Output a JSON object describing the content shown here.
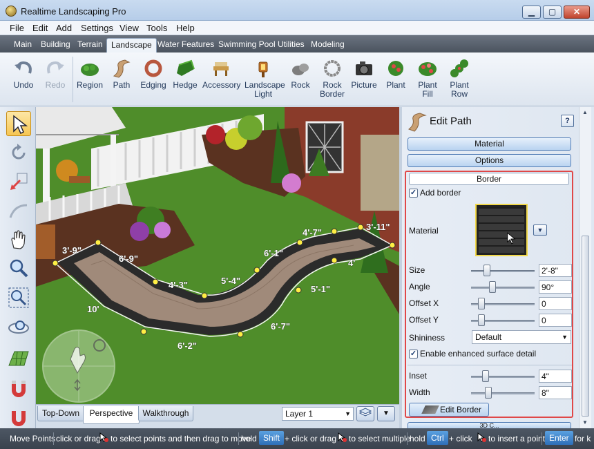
{
  "window": {
    "title": "Realtime Landscaping Pro",
    "controls": {
      "minimize": "▁",
      "maximize": "▢",
      "close": "✕"
    }
  },
  "menu": [
    "File",
    "Edit",
    "Add",
    "Settings",
    "View",
    "Tools",
    "Help"
  ],
  "tabs": [
    "Main",
    "Building",
    "Terrain",
    "Landscape",
    "Water Features",
    "Swimming Pool",
    "Utilities",
    "Modeling"
  ],
  "active_tab": "Landscape",
  "ribbon": {
    "undo": "Undo",
    "redo": "Redo",
    "items": [
      {
        "label1": "Region",
        "label2": "",
        "icon": "region-icon"
      },
      {
        "label1": "Path",
        "label2": "",
        "icon": "path-icon"
      },
      {
        "label1": "Edging",
        "label2": "",
        "icon": "edging-icon"
      },
      {
        "label1": "Hedge",
        "label2": "",
        "icon": "hedge-icon"
      },
      {
        "label1": "Accessory",
        "label2": "",
        "icon": "accessory-icon"
      },
      {
        "label1": "Landscape",
        "label2": "Light",
        "icon": "landscape-light-icon"
      },
      {
        "label1": "Rock",
        "label2": "",
        "icon": "rock-icon"
      },
      {
        "label1": "Rock",
        "label2": "Border",
        "icon": "rock-border-icon"
      },
      {
        "label1": "Picture",
        "label2": "",
        "icon": "camera-icon"
      },
      {
        "label1": "Plant",
        "label2": "",
        "icon": "plant-icon"
      },
      {
        "label1": "Plant",
        "label2": "Fill",
        "icon": "plant-fill-icon"
      },
      {
        "label1": "Plant",
        "label2": "Row",
        "icon": "plant-row-icon"
      }
    ]
  },
  "left_tools": [
    "select-arrow-icon",
    "rotate-icon",
    "resize-icon",
    "curve-icon",
    "pan-hand-icon",
    "zoom-icon",
    "zoom-region-icon",
    "orbit-icon",
    "terrain-grid-icon",
    "magnet-icon",
    "snap-icon"
  ],
  "measurements": [
    "3'-9\"",
    "6'-9\"",
    "4'-3\"",
    "5'-4\"",
    "6'-1\"",
    "4'-7\"",
    "3'-11\"",
    "4'",
    "5'-1\"",
    "6'-7\"",
    "6'-2\"",
    "10'"
  ],
  "view_tabs": [
    "Top-Down",
    "Perspective",
    "Walkthrough"
  ],
  "active_view": "Perspective",
  "layer": "Layer 1",
  "panel": {
    "title": "Edit Path",
    "help": "?",
    "sections": {
      "material": "Material",
      "options": "Options",
      "border": "Border",
      "next": "3D C..."
    },
    "add_border_label": "Add border",
    "add_border_checked": true,
    "material_label": "Material",
    "size_label": "Size",
    "size_value": "2'-8\"",
    "angle_label": "Angle",
    "angle_value": "90°",
    "offset_x_label": "Offset X",
    "offset_x_value": "0",
    "offset_y_label": "Offset Y",
    "offset_y_value": "0",
    "shininess_label": "Shininess",
    "shininess_value": "Default",
    "enhanced_label": "Enable enhanced surface detail",
    "enhanced_checked": true,
    "inset_label": "Inset",
    "inset_value": "4\"",
    "width_label": "Width",
    "width_value": "8\"",
    "edit_border_label": "Edit Border"
  },
  "status": {
    "mode": "Move Points",
    "t1": "click or drag",
    "t2": "to select points and then drag to move",
    "hold1": "hold",
    "key_shift": "Shift",
    "t3": "+ click or drag",
    "t4": "to select multiple",
    "hold2": "hold",
    "key_ctrl": "Ctrl",
    "t5": "+ click",
    "t6": "to insert a point",
    "key_enter": "Enter",
    "t7": "for k"
  },
  "colors": {
    "highlight_border": "#e04848",
    "grass": "#5f9a2e",
    "path_paver": "#a08a7a",
    "path_border": "#2b2b2b"
  }
}
